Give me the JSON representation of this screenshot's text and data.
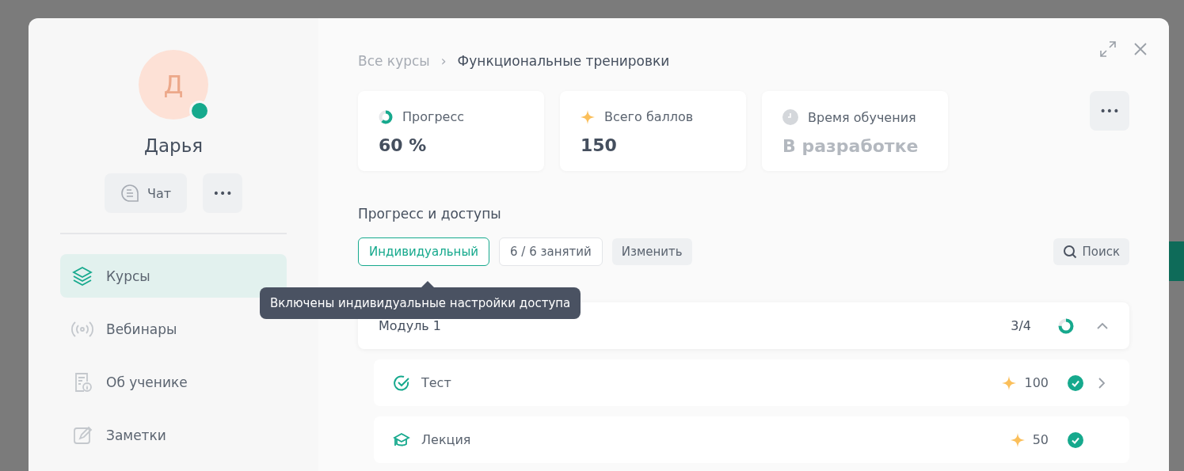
{
  "profile": {
    "initial": "Д",
    "online": true,
    "name": "Дарья",
    "chat_button": "Чат",
    "more_button": "•••"
  },
  "nav": [
    {
      "label": "Курсы",
      "selected": true
    },
    {
      "label": "Вебинары",
      "selected": false
    },
    {
      "label": "Об ученике",
      "selected": false
    },
    {
      "label": "Заметки",
      "selected": false
    }
  ],
  "breadcrumb": {
    "parent": "Все курсы",
    "separator": "›",
    "current": "Функциональные тренировки"
  },
  "stats": [
    {
      "kind": "progress",
      "label": "Прогресс",
      "value": "60 %",
      "level": 0.6,
      "muted": false
    },
    {
      "kind": "points",
      "label": "Всего баллов",
      "value": "150",
      "muted": false
    },
    {
      "kind": "time",
      "label": "Время обучения",
      "value": "В разработке",
      "muted": true
    }
  ],
  "more_button": "•••",
  "section": {
    "title": "Прогресс и доступы",
    "access_chip": "Индивидуальный",
    "lessons_chip": "6 / 6 занятий",
    "change_button": "Изменить",
    "search_button": "Поиск"
  },
  "tooltip": "Включены индивидуальные настройки доступа",
  "module": {
    "title": "Модуль 1",
    "count": "3/4",
    "level": 0.75,
    "expanded": true,
    "items": [
      {
        "kind": "test",
        "title": "Тест",
        "points": "100",
        "completed": true,
        "has_arrow": true
      },
      {
        "kind": "lecture",
        "title": "Лекция",
        "points": "50",
        "completed": true,
        "has_arrow": false
      }
    ]
  }
}
